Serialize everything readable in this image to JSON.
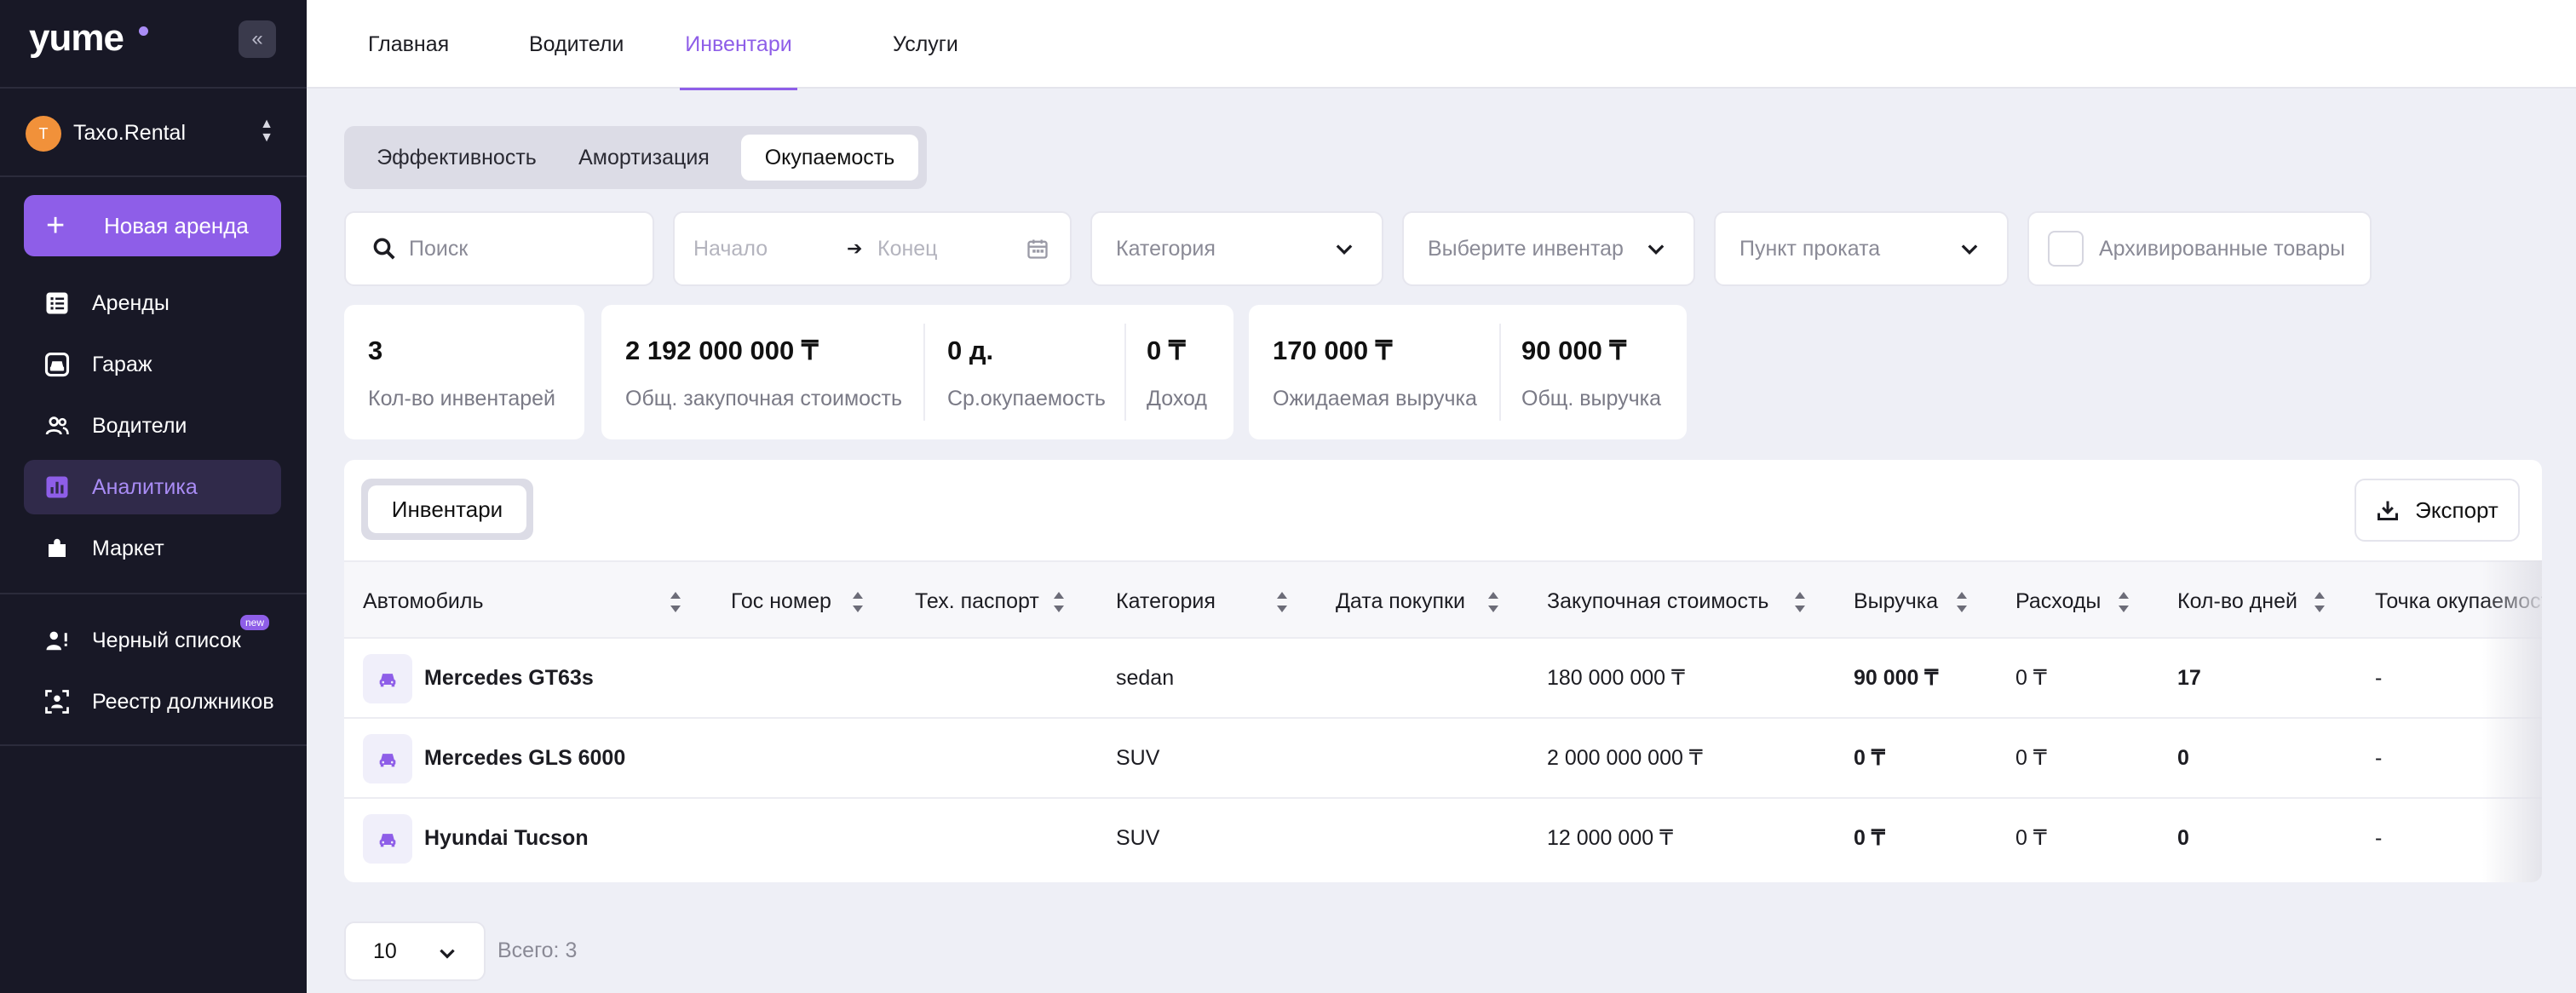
{
  "sidebar": {
    "logo": "yume",
    "org": {
      "initial": "T",
      "name": "Taxo.Rental"
    },
    "new_rent_label": "Новая аренда",
    "items": [
      {
        "label": "Аренды",
        "icon": "list-icon"
      },
      {
        "label": "Гараж",
        "icon": "car-icon"
      },
      {
        "label": "Водители",
        "icon": "users-icon"
      },
      {
        "label": "Аналитика",
        "icon": "analytics-icon",
        "active": true
      },
      {
        "label": "Маркет",
        "icon": "puzzle-icon"
      },
      {
        "label": "Черный список",
        "icon": "user-block-icon",
        "badge": "new"
      },
      {
        "label": "Реестр должников",
        "icon": "face-scan-icon"
      }
    ]
  },
  "top_tabs": [
    "Главная",
    "Водители",
    "Инвентари",
    "Услуги"
  ],
  "active_top_tab": "Инвентари",
  "segments": [
    "Эффективность",
    "Амортизация",
    "Окупаемость"
  ],
  "active_segment": "Окупаемость",
  "filters": {
    "search_placeholder": "Поиск",
    "date_start": "Начало",
    "date_end": "Конец",
    "category": "Категория",
    "inventory": "Выберите инвентарь",
    "rental_point": "Пункт проката",
    "archived": "Архивированные товары"
  },
  "stats": {
    "inventory_count": {
      "value": "3",
      "label": "Кол-во инвентарей"
    },
    "total_purchase": {
      "value": "2 192 000 000 ₸",
      "label": "Общ. закупочная стоимость"
    },
    "avg_payback": {
      "value": "0 д.",
      "label": "Ср.окупаемость"
    },
    "income": {
      "value": "0 ₸",
      "label": "Доход"
    },
    "expected_revenue": {
      "value": "170 000 ₸",
      "label": "Ожидаемая выручка"
    },
    "total_revenue": {
      "value": "90 000 ₸",
      "label": "Общ. выручка"
    }
  },
  "table": {
    "tab_label": "Инвентари",
    "export_label": "Экспорт",
    "columns": [
      "Автомобиль",
      "Гос номер",
      "Тех. паспорт",
      "Категория",
      "Дата покупки",
      "Закупочная стоимость",
      "Выручка",
      "Расходы",
      "Кол-во дней",
      "Точка окупаемости"
    ],
    "rows": [
      {
        "car": "Mercedes GT63s",
        "plate": "",
        "passport": "",
        "category": "sedan",
        "date": "",
        "purchase": "180 000 000 ₸",
        "revenue": "90 000 ₸",
        "expenses": "0 ₸",
        "days": "17",
        "payback": "-"
      },
      {
        "car": "Mercedes GLS 6000",
        "plate": "",
        "passport": "",
        "category": "SUV",
        "date": "",
        "purchase": "2 000 000 000 ₸",
        "revenue": "0 ₸",
        "expenses": "0 ₸",
        "days": "0",
        "payback": "-"
      },
      {
        "car": "Hyundai Tucson",
        "plate": "",
        "passport": "",
        "category": "SUV",
        "date": "",
        "purchase": "12 000 000 ₸",
        "revenue": "0 ₸",
        "expenses": "0 ₸",
        "days": "0",
        "payback": "-"
      }
    ]
  },
  "pagination": {
    "page_size": "10",
    "total": "Всего: 3"
  },
  "colors": {
    "accent": "#8e5ee8",
    "sidebar_bg": "#181826",
    "page_bg": "#eeeff6",
    "avatar": "#f1913a"
  }
}
